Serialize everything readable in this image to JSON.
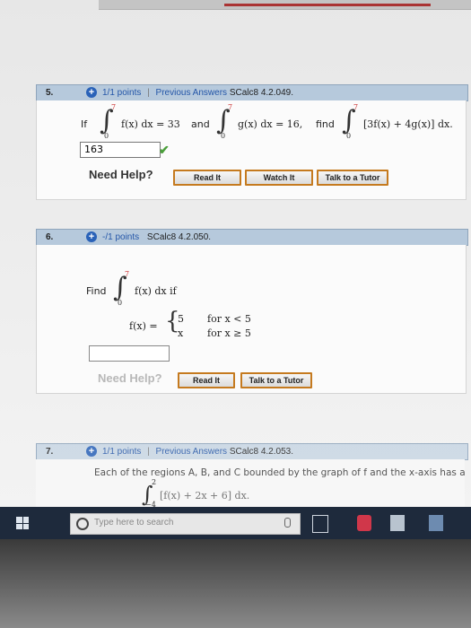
{
  "q5": {
    "number": "5.",
    "points": "1/1 points",
    "separator": "|",
    "prev_answers": "Previous Answers",
    "code": "SCalc8 4.2.049.",
    "if_text": "If",
    "int1_upper": "7",
    "int1_lower": "0",
    "int1_body": "f(x) dx = 33",
    "and_text": "and",
    "int2_upper": "7",
    "int2_lower": "0",
    "int2_body": "g(x) dx = 16,",
    "find_text": "find",
    "int3_upper": "7",
    "int3_lower": "0",
    "int3_body": "[3f(x) + 4g(x)] dx.",
    "answer": "163",
    "need_help": "Need Help?",
    "read_it": "Read It",
    "watch_it": "Watch It",
    "talk_tutor": "Talk to a Tutor"
  },
  "q6": {
    "number": "6.",
    "points": "-/1 points",
    "code": "SCalc8 4.2.050.",
    "find_text": "Find",
    "int_upper": "7",
    "int_lower": "0",
    "int_body": "f(x) dx  if",
    "fx_label": "f(x) =",
    "case1_val": "5",
    "case1_cond": "for x < 5",
    "case2_val": "x",
    "case2_cond": "for x ≥ 5",
    "answer": "",
    "need_help": "Need Help?",
    "read_it": "Read It",
    "talk_tutor": "Talk to a Tutor"
  },
  "q7": {
    "number": "7.",
    "points": "1/1 points",
    "separator": "|",
    "prev_answers": "Previous Answers",
    "code": "SCalc8 4.2.053.",
    "text": "Each of the regions A, B, and C bounded by the graph of f and the x-axis has a",
    "int_upper": "2",
    "int_lower": "−4",
    "int_body": "[f(x) + 2x + 6] dx."
  },
  "taskbar": {
    "search_placeholder": "Type here to search"
  }
}
